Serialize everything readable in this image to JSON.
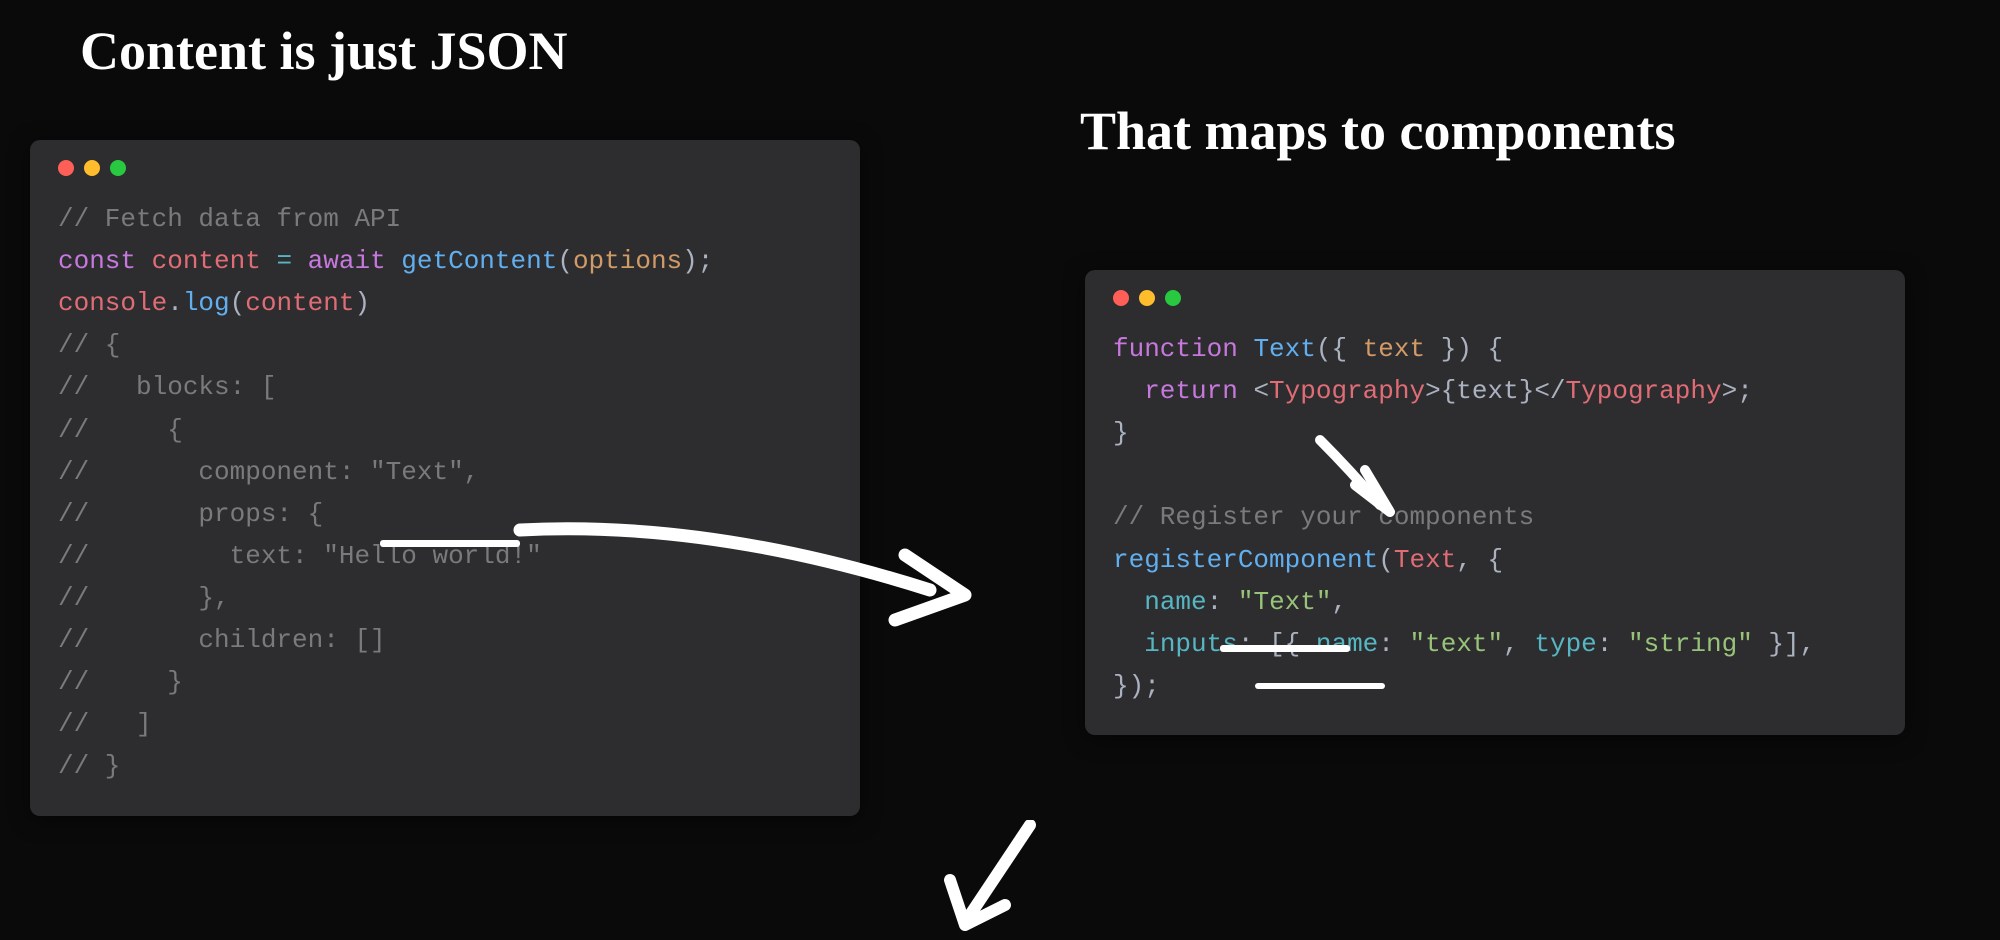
{
  "titles": {
    "left": "Content is just JSON",
    "right": "That maps to components"
  },
  "code_left": {
    "comment1": "// Fetch data from API",
    "line2": {
      "kw_const": "const",
      "var": "content",
      "eq": "=",
      "await": "await",
      "fn": "getContent",
      "lp": "(",
      "arg": "options",
      "rp": ")",
      "semi": ";"
    },
    "line3": {
      "obj": "console",
      "dot": ".",
      "method": "log",
      "lp": "(",
      "arg": "content",
      "rp": ")"
    },
    "l4": "// {",
    "l5": "//   blocks: [",
    "l6": "//     {",
    "l7": "//       component: \"Text\",",
    "l8": "//       props: {",
    "l9": "//         text: \"Hello world!\"",
    "l10": "//       },",
    "l11": "//       children: []",
    "l12": "//     }",
    "l13": "//   ]",
    "l14": "// }"
  },
  "code_right": {
    "l1": {
      "kw": "function",
      "name": "Text",
      "lp": "(",
      "lb": "{ ",
      "param": "text",
      "rb": " }",
      "rp": ")",
      "ob": " {"
    },
    "l2": {
      "ret": "  return ",
      "lt1": "<",
      "tag1": "Typography",
      "gt1": ">",
      "lbr": "{",
      "expr": "text",
      "rbr": "}",
      "lt2": "</",
      "tag2": "Typography",
      "gt2": ">",
      "semi": ";"
    },
    "l3": "}",
    "blank": "",
    "l5": "// Register your components",
    "l6": {
      "fn": "registerComponent",
      "lp": "(",
      "arg1": "Text",
      "comma": ", ",
      "lb": "{"
    },
    "l7": {
      "indent": "  ",
      "key": "name",
      "colon": ": ",
      "val": "\"Text\"",
      "comma": ","
    },
    "l8": {
      "indent": "  ",
      "key": "inputs",
      "colon": ": ",
      "lb": "[{ ",
      "k1": "name",
      "c1": ": ",
      "v1": "\"text\"",
      "sep": ", ",
      "k2": "type",
      "c2": ": ",
      "v2": "\"string\"",
      "rb": " }]",
      "comma": ","
    },
    "l9": "});"
  },
  "colors": {
    "bg": "#0a0a0a",
    "window": "#2d2d30",
    "red": "#ff5f57",
    "yellow": "#ffbd2e",
    "green": "#28c940"
  }
}
